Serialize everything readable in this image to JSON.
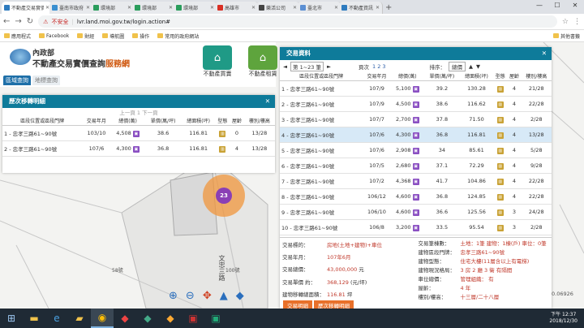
{
  "browser": {
    "tabs": [
      {
        "label": "不動產交易實價",
        "color": "#2e7bbf",
        "active": true
      },
      {
        "label": "臺南市政府",
        "color": "#3a8fd0"
      },
      {
        "label": "環境部",
        "color": "#2a9d5c"
      },
      {
        "label": "環境部",
        "color": "#2a9d5c"
      },
      {
        "label": "環境部",
        "color": "#2a9d5c"
      },
      {
        "label": "高雄市",
        "color": "#d93025"
      },
      {
        "label": "樂活公司",
        "color": "#444444"
      },
      {
        "label": "臺北市",
        "color": "#5b8fd3"
      },
      {
        "label": "不動產資訊",
        "color": "#2e7bbf"
      }
    ],
    "new_tab": "+",
    "url_warning": "不安全",
    "url": "lvr.land.moi.gov.tw/login.action#",
    "bookmarks": [
      "應用程式",
      "Facebook",
      "財經",
      "導航圖",
      "操作",
      "常用的政府網站",
      "其他書籤"
    ]
  },
  "site": {
    "ministry": "內政部",
    "title_main": "不動產交易實價查詢",
    "title_accent": "服務網",
    "nav_buy": "不動產買賣",
    "nav_rent": "不動產租賃",
    "tabs": [
      "區域查詢",
      "地標查詢"
    ]
  },
  "history_panel": {
    "title": "歷次移轉明細",
    "pager": "上一頁 1 下一頁",
    "headers": [
      "區段位置或區段門牌",
      "交易年月",
      "總價(萬)",
      "單價(萬/坪)",
      "總面積(坪)",
      "型態",
      "屋齡",
      "樓別/樓高"
    ],
    "rows": [
      {
        "addr": "1 - 忠孝三路61~90號",
        "date": "103/10",
        "total": "4,508",
        "unit": "38.6",
        "area": "116.81",
        "age": "0",
        "floor": "13/28"
      },
      {
        "addr": "2 - 忠孝三路61~90號",
        "date": "107/6",
        "total": "4,300",
        "unit": "36.8",
        "area": "116.81",
        "age": "4",
        "floor": "13/28"
      }
    ]
  },
  "cluster_count": "23",
  "street_label": "文忠三路",
  "lane_label": "58號",
  "lot_label": "100號",
  "scale_label": "0.06926",
  "tx_panel": {
    "title": "交易資料",
    "page_select": "第 1~23 筆",
    "pages_label": "頁次",
    "pages": "1 2 3",
    "sort_label": "排序：",
    "sort_value": "總價",
    "headers": [
      "區段位置或區段門牌",
      "交易年月",
      "總價(萬)",
      "單價(萬/坪)",
      "總面積(坪)",
      "型態",
      "屋齡",
      "樓別/樓高"
    ],
    "rows": [
      {
        "addr": "1 - 忠孝三路61~90號",
        "date": "107/9",
        "total": "5,100",
        "unit": "39.2",
        "area": "130.28",
        "age": "4",
        "floor": "21/28"
      },
      {
        "addr": "2 - 忠孝三路61~90號",
        "date": "107/9",
        "total": "4,500",
        "unit": "38.6",
        "area": "116.62",
        "age": "4",
        "floor": "22/28"
      },
      {
        "addr": "3 - 忠孝三路61~90號",
        "date": "107/7",
        "total": "2,700",
        "unit": "37.8",
        "area": "71.50",
        "age": "4",
        "floor": "2/28"
      },
      {
        "addr": "4 - 忠孝三路61~90號",
        "date": "107/6",
        "total": "4,300",
        "unit": "36.8",
        "area": "116.81",
        "age": "4",
        "floor": "13/28"
      },
      {
        "addr": "5 - 忠孝三路61~90號",
        "date": "107/6",
        "total": "2,908",
        "unit": "34",
        "area": "85.61",
        "age": "4",
        "floor": "5/28"
      },
      {
        "addr": "6 - 忠孝三路61~90號",
        "date": "107/5",
        "total": "2,680",
        "unit": "37.1",
        "area": "72.29",
        "age": "4",
        "floor": "9/28"
      },
      {
        "addr": "7 - 忠孝三路61~90號",
        "date": "107/2",
        "total": "4,368",
        "unit": "41.7",
        "area": "104.86",
        "age": "4",
        "floor": "22/28"
      },
      {
        "addr": "8 - 忠孝三路61~90號",
        "date": "106/12",
        "total": "4,600",
        "unit": "36.8",
        "area": "124.85",
        "age": "4",
        "floor": "22/28"
      },
      {
        "addr": "9 - 忠孝三路61~90號",
        "date": "106/10",
        "total": "4,600",
        "unit": "36.6",
        "area": "125.56",
        "age": "3",
        "floor": "24/28"
      },
      {
        "addr": "10 - 忠孝三路61~90號",
        "date": "106/8",
        "total": "3,200",
        "unit": "33.5",
        "area": "95.54",
        "age": "3",
        "floor": "2/28"
      }
    ],
    "selected_index": 3,
    "detail_left": [
      {
        "label": "交易標的：",
        "value": "房地(土地+建物)+車位"
      },
      {
        "label": "交易年月：",
        "value": "107年6月"
      },
      {
        "label": "交易總價：",
        "value": "43,000,000",
        "unit": "元"
      },
      {
        "label": "交易單價 約：",
        "value": "368,129",
        "unit": "(元/坪)"
      },
      {
        "label": "建物移轉總面積：",
        "value": "116.81",
        "unit": "坪"
      }
    ],
    "detail_right": [
      {
        "label": "交易筆棟數：",
        "value": "土地：1筆 建物：1棟(戶) 車位：0筆"
      },
      {
        "label": "建物區段門牌：",
        "value": "忠孝三路61~90號"
      },
      {
        "label": "建物型態：",
        "value": "住宅大樓(11層含以上有電梯)"
      },
      {
        "label": "建物現況格局：",
        "value": "3 房 2 廳 3 衛 有隔間"
      },
      {
        "label": "車位總價：",
        "value": "管理組織：",
        "extra": "有"
      },
      {
        "label": "屋齡：",
        "value": "4 年"
      },
      {
        "label": "樓別/樓高：",
        "value": "十三層/二十八層"
      }
    ],
    "bottom_tabs": [
      "交易明細",
      "歷次移轉明細"
    ]
  },
  "taskbar": {
    "time": "下午 12:37",
    "date": "2018/12/30"
  }
}
